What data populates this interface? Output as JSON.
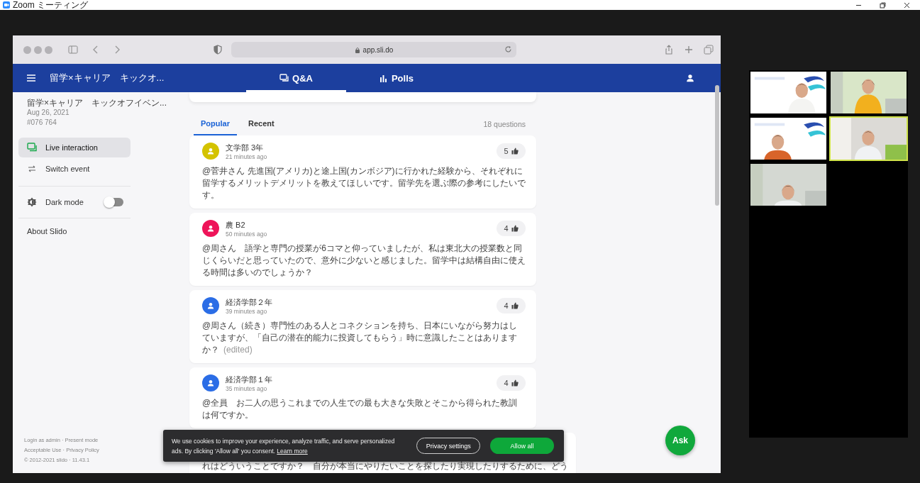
{
  "window": {
    "title": "Zoom ミーティング"
  },
  "browser": {
    "url": "app.sli.do"
  },
  "header": {
    "event_title": "留学×キャリア　キックオ...",
    "tabs": [
      {
        "label": "Q&A",
        "selected": true
      },
      {
        "label": "Polls",
        "selected": false
      }
    ]
  },
  "sidebar": {
    "event_title": "留学×キャリア　キックオフイベン...",
    "date": "Aug 26, 2021",
    "code": "#076 764",
    "items": [
      {
        "label": "Live interaction",
        "selected": true
      },
      {
        "label": "Switch event",
        "selected": false
      }
    ],
    "dark_mode": {
      "label": "Dark mode",
      "on": false
    },
    "about": "About Slido",
    "footer": [
      "Login as admin · Present mode",
      "Acceptable Use · Privacy Policy",
      "© 2012-2021 slido · 11.43.1"
    ]
  },
  "questions": {
    "tabs": [
      {
        "label": "Popular",
        "selected": true
      },
      {
        "label": "Recent",
        "selected": false
      }
    ],
    "count": "18 questions",
    "items": [
      {
        "author": "文学部 3年",
        "time": "21 minutes ago",
        "text": "@菅井さん 先進国(アメリカ)と途上国(カンボジア)に行かれた経験から、それぞれに留学するメリットデメリットを教えてほしいです。留学先を選ぶ際の参考にしたいです。",
        "votes": "5",
        "color": "#d4c300"
      },
      {
        "author": "農 B2",
        "time": "50 minutes ago",
        "text": "@周さん　語学と専門の授業が6コマと仰っていましたが、私は東北大の授業数と同じくらいだと思っていたので、意外に少ないと感じました。留学中は結構自由に使える時間は多いのでしょうか？",
        "votes": "4",
        "color": "#ee1459"
      },
      {
        "author": "経済学部２年",
        "time": "39 minutes ago",
        "text": "@周さん（続き）専門性のある人とコネクションを持ち、日本にいながら努力はしていますが、「自己の潜在的能力に投資してもらう」時に意識したことはありますか？",
        "edited_note": "(edited)",
        "votes": "4",
        "color": "#2b6de6"
      },
      {
        "author": "経済学部１年",
        "time": "35 minutes ago",
        "text": "@全員　お二人の思うこれまでの人生での最も大きな失敗とそこから得られた教訓は何ですか。",
        "votes": "4",
        "color": "#2b6de6"
      },
      {
        "text": "れはどういうことですか？　自分が本当にやりたいことを探したり実現したりするために、どう"
      }
    ]
  },
  "cookie_banner": {
    "text": "We use cookies to improve your experience, analyze traffic, and serve personalized ads. By clicking 'Allow all' you consent.",
    "link": "Learn more",
    "buttons": [
      {
        "label": "Privacy settings",
        "kind": "outline"
      },
      {
        "label": "Allow all",
        "kind": "primary"
      }
    ]
  },
  "ask_button": "Ask",
  "gallery": {
    "tiles": [
      {
        "kind": "picture",
        "active": false
      },
      {
        "kind": "picture",
        "active": false
      },
      {
        "kind": "picture",
        "active": false
      },
      {
        "kind": "picture",
        "active": true
      },
      {
        "kind": "picture",
        "active": false
      }
    ]
  }
}
